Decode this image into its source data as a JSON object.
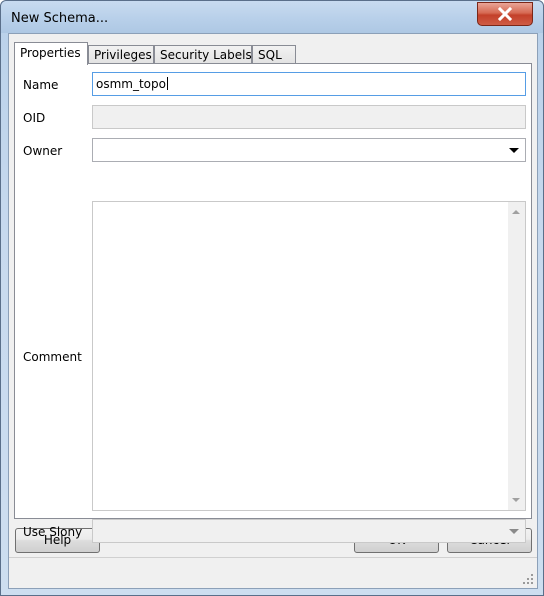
{
  "window": {
    "title": "New Schema..."
  },
  "tabs": [
    {
      "label": "Properties"
    },
    {
      "label": "Privileges"
    },
    {
      "label": "Security Labels"
    },
    {
      "label": "SQL"
    }
  ],
  "form": {
    "name_label": "Name",
    "name_value": "osmm_topo",
    "oid_label": "OID",
    "oid_value": "",
    "owner_label": "Owner",
    "owner_value": "",
    "comment_label": "Comment",
    "comment_value": "",
    "slony_label": "Use Slony",
    "slony_value": ""
  },
  "buttons": {
    "help": "Help",
    "ok": "OK",
    "cancel": "Cancel"
  },
  "icons": {
    "close": "close-icon",
    "owner_dropdown": "chevron-down-icon",
    "slony_dropdown": "chevron-down-icon",
    "resize": "resize-grip-icon"
  },
  "colors": {
    "titlebar": "#b9d1ea",
    "close_button": "#c3402a",
    "dialog_background": "#f0f0f0",
    "focus_border": "#569de5"
  }
}
